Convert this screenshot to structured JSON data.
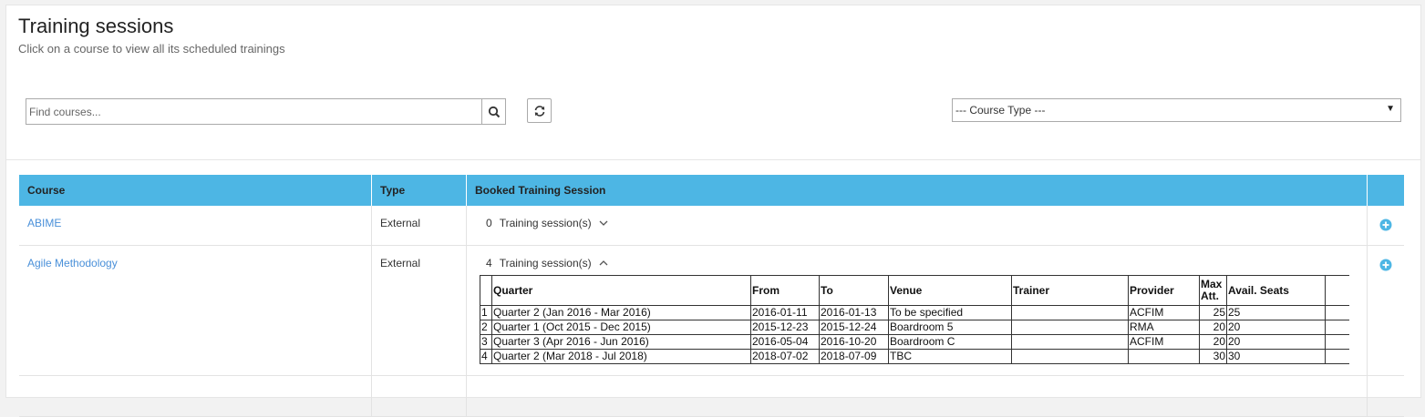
{
  "page": {
    "title": "Training sessions",
    "subtitle": "Click on a course to view all its scheduled trainings"
  },
  "search": {
    "placeholder": "Find courses...",
    "value": ""
  },
  "filter": {
    "course_type_selected": "--- Course Type ---"
  },
  "icons": {
    "search": "search-icon",
    "refresh": "refresh-icon",
    "expand": "chevron-down-icon",
    "collapse": "chevron-up-icon",
    "add": "plus-circle-icon"
  },
  "colors": {
    "header_bg": "#4db6e4",
    "link": "#4a90d9",
    "add_icon": "#4db6e4"
  },
  "grid": {
    "headers": [
      "Course",
      "Type",
      "Booked Training Session",
      ""
    ],
    "rows": [
      {
        "course": "ABIME",
        "type": "External",
        "session_count": "0",
        "session_label": "Training session(s)",
        "expanded": false
      },
      {
        "course": "Agile Methodology",
        "type": "External",
        "session_count": "4",
        "session_label": "Training session(s)",
        "expanded": true
      }
    ]
  },
  "sessions_table": {
    "headers": [
      "",
      "Quarter",
      "From",
      "To",
      "Venue",
      "Trainer",
      "Provider",
      "Max Att.",
      "Avail. Seats",
      ""
    ],
    "rows": [
      [
        "1",
        "Quarter 2 (Jan 2016 - Mar 2016)",
        "2016-01-11",
        "2016-01-13",
        "To be specified",
        "",
        "ACFIM",
        "25",
        "25",
        ""
      ],
      [
        "2",
        "Quarter 1 (Oct 2015 - Dec 2015)",
        "2015-12-23",
        "2015-12-24",
        "Boardroom 5",
        "",
        "RMA",
        "20",
        "20",
        ""
      ],
      [
        "3",
        "Quarter 3 (Apr 2016 - Jun 2016)",
        "2016-05-04",
        "2016-10-20",
        "Boardroom C",
        "",
        "ACFIM",
        "20",
        "20",
        ""
      ],
      [
        "4",
        "Quarter 2 (Mar 2018 - Jul 2018)",
        "2018-07-02",
        "2018-07-09",
        "TBC",
        "",
        "",
        "30",
        "30",
        ""
      ]
    ]
  }
}
